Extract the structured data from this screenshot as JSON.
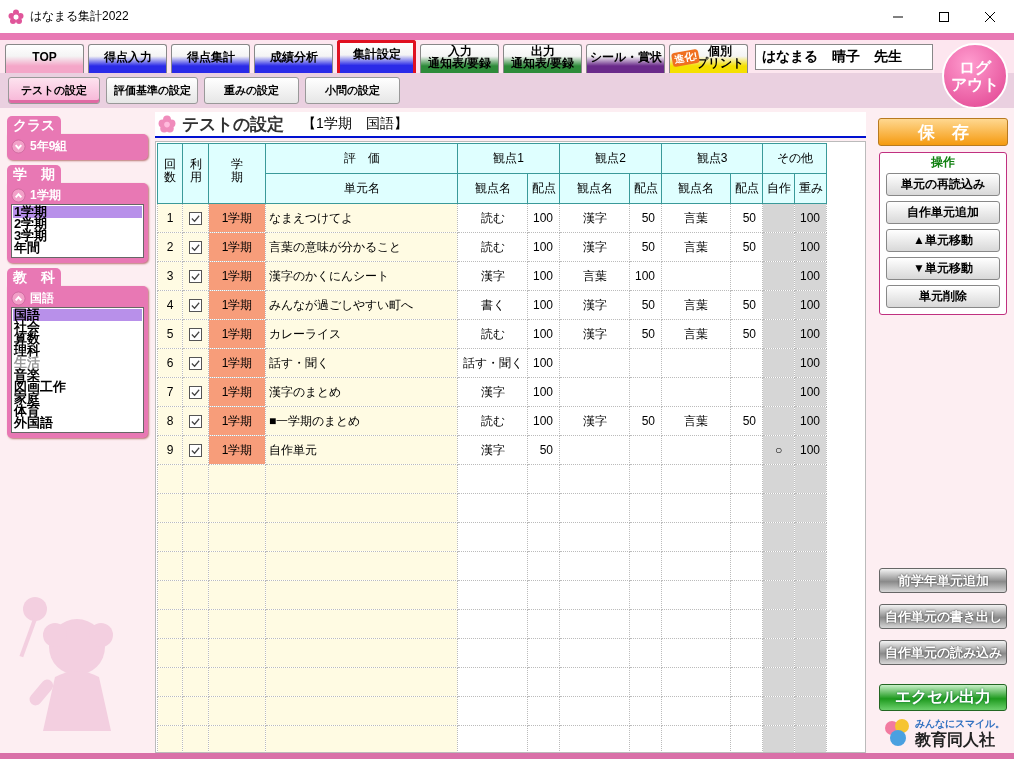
{
  "window": {
    "title": "はなまる集計2022"
  },
  "tabs": [
    {
      "label": "TOP",
      "color": "#f4a6c8",
      "selected": false
    },
    {
      "label": "得点入力",
      "color": "#2a2ae8",
      "selected": false
    },
    {
      "label": "得点集計",
      "color": "#2a2ae8",
      "selected": false
    },
    {
      "label": "成績分析",
      "color": "#2a2ae8",
      "selected": false
    },
    {
      "label": "集計設定",
      "color": "#2a2ae8",
      "selected": true
    },
    {
      "lines": [
        "入力",
        "通知表/要録"
      ],
      "color": "#2e8b3a",
      "selected": false
    },
    {
      "lines": [
        "出力",
        "通知表/要録"
      ],
      "color": "#2e8b3a",
      "selected": false
    },
    {
      "label": "シール・賞状",
      "color": "#6a2a8a",
      "selected": false
    },
    {
      "lines": [
        "個別",
        "プリント"
      ],
      "color": "#f5e000",
      "badge": "進化!",
      "selected": false
    }
  ],
  "user": {
    "name": "はなまる　晴子　先生"
  },
  "logout": {
    "lines": [
      "ログ",
      "アウト"
    ]
  },
  "subtabs": [
    {
      "label": "テストの設定",
      "selected": true
    },
    {
      "label": "評価基準の設定",
      "selected": false
    },
    {
      "label": "重みの設定",
      "selected": false
    },
    {
      "label": "小問の設定",
      "selected": false
    }
  ],
  "sidebar": [
    {
      "title": "クラス",
      "value": "5年9組",
      "expanded": false
    },
    {
      "title": "学　期",
      "value": "1学期",
      "expanded": true,
      "items": [
        {
          "label": "1学期",
          "selected": true,
          "disabled": false
        },
        {
          "label": "2学期",
          "selected": false,
          "disabled": false
        },
        {
          "label": "3学期",
          "selected": false,
          "disabled": false
        },
        {
          "label": "年間",
          "selected": false,
          "disabled": false
        }
      ]
    },
    {
      "title": "教　科",
      "value": "国語",
      "expanded": true,
      "items": [
        {
          "label": "国語",
          "selected": true,
          "disabled": false
        },
        {
          "label": "社会",
          "selected": false,
          "disabled": false
        },
        {
          "label": "算数",
          "selected": false,
          "disabled": false
        },
        {
          "label": "理科",
          "selected": false,
          "disabled": false
        },
        {
          "label": "生活",
          "selected": false,
          "disabled": true
        },
        {
          "label": "音楽",
          "selected": false,
          "disabled": false
        },
        {
          "label": "図画工作",
          "selected": false,
          "disabled": false
        },
        {
          "label": "家庭",
          "selected": false,
          "disabled": false
        },
        {
          "label": "体育",
          "selected": false,
          "disabled": false
        },
        {
          "label": "外国語",
          "selected": false,
          "disabled": false
        }
      ]
    }
  ],
  "page": {
    "title": "テストの設定",
    "context": "【1学期　国語】"
  },
  "table": {
    "group_headers": {
      "count": "回数",
      "used": "利用",
      "term": "学期",
      "evaluation": "評　価",
      "view1": "観点1",
      "view2": "観点2",
      "view3": "観点3",
      "other": "その他"
    },
    "sub_headers": {
      "unit": "単元名",
      "view1_name": "観点名",
      "view1_points": "配点",
      "view2_name": "観点名",
      "view2_points": "配点",
      "view3_name": "観点名",
      "view3_points": "配点",
      "custom": "自作",
      "weight": "重み"
    },
    "rows": [
      {
        "no": "1",
        "used": true,
        "term": "1学期",
        "unit": "なまえつけてよ",
        "v1": "読む",
        "p1": "100",
        "v2": "漢字",
        "p2": "50",
        "v3": "言葉",
        "p3": "50",
        "custom": "",
        "weight": "100"
      },
      {
        "no": "2",
        "used": true,
        "term": "1学期",
        "unit": "言葉の意味が分かること",
        "v1": "読む",
        "p1": "100",
        "v2": "漢字",
        "p2": "50",
        "v3": "言葉",
        "p3": "50",
        "custom": "",
        "weight": "100"
      },
      {
        "no": "3",
        "used": true,
        "term": "1学期",
        "unit": "漢字のかくにんシート",
        "v1": "漢字",
        "p1": "100",
        "v2": "言葉",
        "p2": "100",
        "v3": "",
        "p3": "",
        "custom": "",
        "weight": "100"
      },
      {
        "no": "4",
        "used": true,
        "term": "1学期",
        "unit": "みんなが過ごしやすい町へ",
        "v1": "書く",
        "p1": "100",
        "v2": "漢字",
        "p2": "50",
        "v3": "言葉",
        "p3": "50",
        "custom": "",
        "weight": "100"
      },
      {
        "no": "5",
        "used": true,
        "term": "1学期",
        "unit": "カレーライス",
        "v1": "読む",
        "p1": "100",
        "v2": "漢字",
        "p2": "50",
        "v3": "言葉",
        "p3": "50",
        "custom": "",
        "weight": "100"
      },
      {
        "no": "6",
        "used": true,
        "term": "1学期",
        "unit": "話す・聞く",
        "v1": "話す・聞く",
        "p1": "100",
        "v2": "",
        "p2": "",
        "v3": "",
        "p3": "",
        "custom": "",
        "weight": "100"
      },
      {
        "no": "7",
        "used": true,
        "term": "1学期",
        "unit": "漢字のまとめ",
        "v1": "漢字",
        "p1": "100",
        "v2": "",
        "p2": "",
        "v3": "",
        "p3": "",
        "custom": "",
        "weight": "100"
      },
      {
        "no": "8",
        "used": true,
        "term": "1学期",
        "unit": "■一学期のまとめ",
        "v1": "読む",
        "p1": "100",
        "v2": "漢字",
        "p2": "50",
        "v3": "言葉",
        "p3": "50",
        "custom": "",
        "weight": "100"
      },
      {
        "no": "9",
        "used": true,
        "term": "1学期",
        "unit": "自作単元",
        "v1": "漢字",
        "p1": "50",
        "v2": "",
        "p2": "",
        "v3": "",
        "p3": "",
        "custom": "○",
        "weight": "100"
      }
    ]
  },
  "save_button": "保　存",
  "operations": {
    "title": "操作",
    "buttons": [
      "単元の再読込み",
      "自作単元追加",
      "▲単元移動",
      "▼単元移動",
      "単元削除"
    ]
  },
  "file_buttons": [
    "前学年単元追加",
    "自作単元の書き出し",
    "自作単元の読み込み"
  ],
  "excel_button": "エクセル出力",
  "logo": {
    "tagline": "みんなにスマイル。",
    "name": "教育同人社"
  }
}
